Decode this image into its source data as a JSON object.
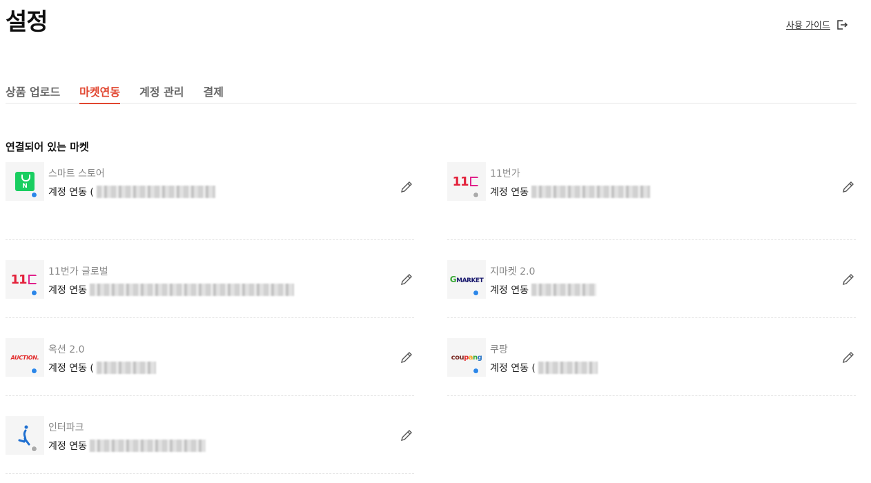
{
  "header": {
    "title": "설정",
    "guide_label": "사용 가이드"
  },
  "tabs": [
    {
      "label": "상품 업로드"
    },
    {
      "label": "마켓연동"
    },
    {
      "label": "계정 관리"
    },
    {
      "label": "결제"
    }
  ],
  "active_tab": "마켓연동",
  "section": {
    "title": "연결되어 있는 마켓"
  },
  "markets": [
    {
      "name": "스마트 스토어",
      "account_label": "계정 연동 (",
      "logo": "naver-smartstore-icon",
      "status_color": "#2b86e8"
    },
    {
      "name": "11번가",
      "account_label": "계정 연동",
      "logo": "11st-icon",
      "status_color": "#aaaaaa"
    },
    {
      "name": "11번가 글로벌",
      "account_label": "계정 연동",
      "logo": "11st-global-icon",
      "status_color": "#2b86e8"
    },
    {
      "name": "지마켓 2.0",
      "account_label": "계정 연동",
      "logo": "gmarket-icon",
      "status_color": "#2b86e8"
    },
    {
      "name": "옥션 2.0",
      "account_label": "계정 연동 (",
      "logo": "auction-icon",
      "status_color": "#2b86e8"
    },
    {
      "name": "쿠팡",
      "account_label": "계정 연동 (",
      "logo": "coupang-icon",
      "status_color": "#2b86e8"
    },
    {
      "name": "인터파크",
      "account_label": "계정 연동",
      "logo": "interpark-icon",
      "status_color": "#aaaaaa"
    }
  ],
  "logo_text": {
    "naver": "N",
    "eleven": "11",
    "gmarket_g": "G",
    "gmarket_rest": "MARKET",
    "auction": "AUCTION.",
    "coupang": [
      "cou",
      "p",
      "a",
      "n",
      "g"
    ]
  },
  "colors": {
    "accent": "#e1452f",
    "status_on": "#2b86e8",
    "status_off": "#aaaaaa"
  }
}
